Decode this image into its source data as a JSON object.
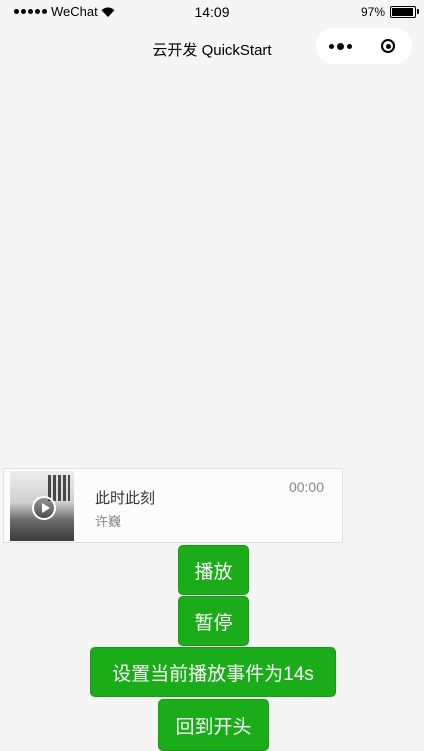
{
  "status_bar": {
    "carrier": "WeChat",
    "time": "14:09",
    "battery_percent": "97%",
    "battery_level": 0.97
  },
  "nav_bar": {
    "title": "云开发 QuickStart"
  },
  "audio": {
    "title": "此时此刻",
    "author": "许巍",
    "time": "00:00"
  },
  "buttons": {
    "play": "播放",
    "pause": "暂停",
    "seek": "设置当前播放事件为14s",
    "restart": "回到开头"
  }
}
